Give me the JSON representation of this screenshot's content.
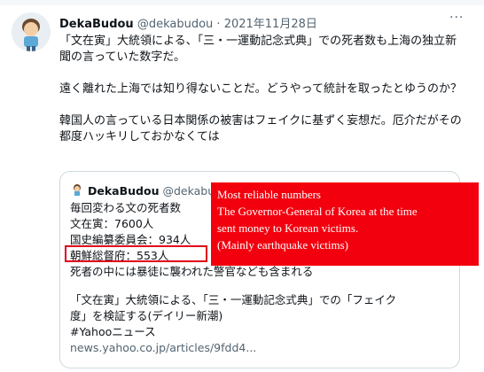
{
  "tweet": {
    "author_name": "DekaBudou",
    "author_handle": "@dekabudou",
    "separator": " · ",
    "date": "2021年11月28日",
    "more_icon": "more-icon",
    "paragraphs": [
      "「文在寅」大統領による、「三・一運動記念式典」での死者数も上海の独立新聞の言っていた数字だ。",
      "遠く離れた上海では知り得ないことだ。どうやって統計を取ったとゆうのか？",
      "韓国人の言っている日本関係の被害はフェイクに基ずく妄想だ。厄介だがその都度ハッキリしておかなくては"
    ]
  },
  "quote": {
    "author_name": "DekaBudou",
    "author_handle": "@dekabudo",
    "lines": [
      "毎回変わる文の死者数",
      "文在寅：7600人",
      "国史編纂委員会：934人",
      "朝鮮総督府：553人",
      "死者の中には暴徒に襲われた警官なども含まれる"
    ],
    "article_lines": [
      "「文在寅」大統領による、「三・一運動記念式典」での「フェイク",
      "度」を検証する(デイリー新潮)",
      "#Yahooニュース"
    ],
    "link": "news.yahoo.co.jp/articles/9fdd4..."
  },
  "annotation": {
    "lines": [
      "Most reliable numbers",
      "The Governor-General of Korea at the time",
      "sent money to Korean victims.",
      "(Mainly earthquake victims)"
    ],
    "background": "#f3000f",
    "highlight_border": "#e0001a"
  }
}
